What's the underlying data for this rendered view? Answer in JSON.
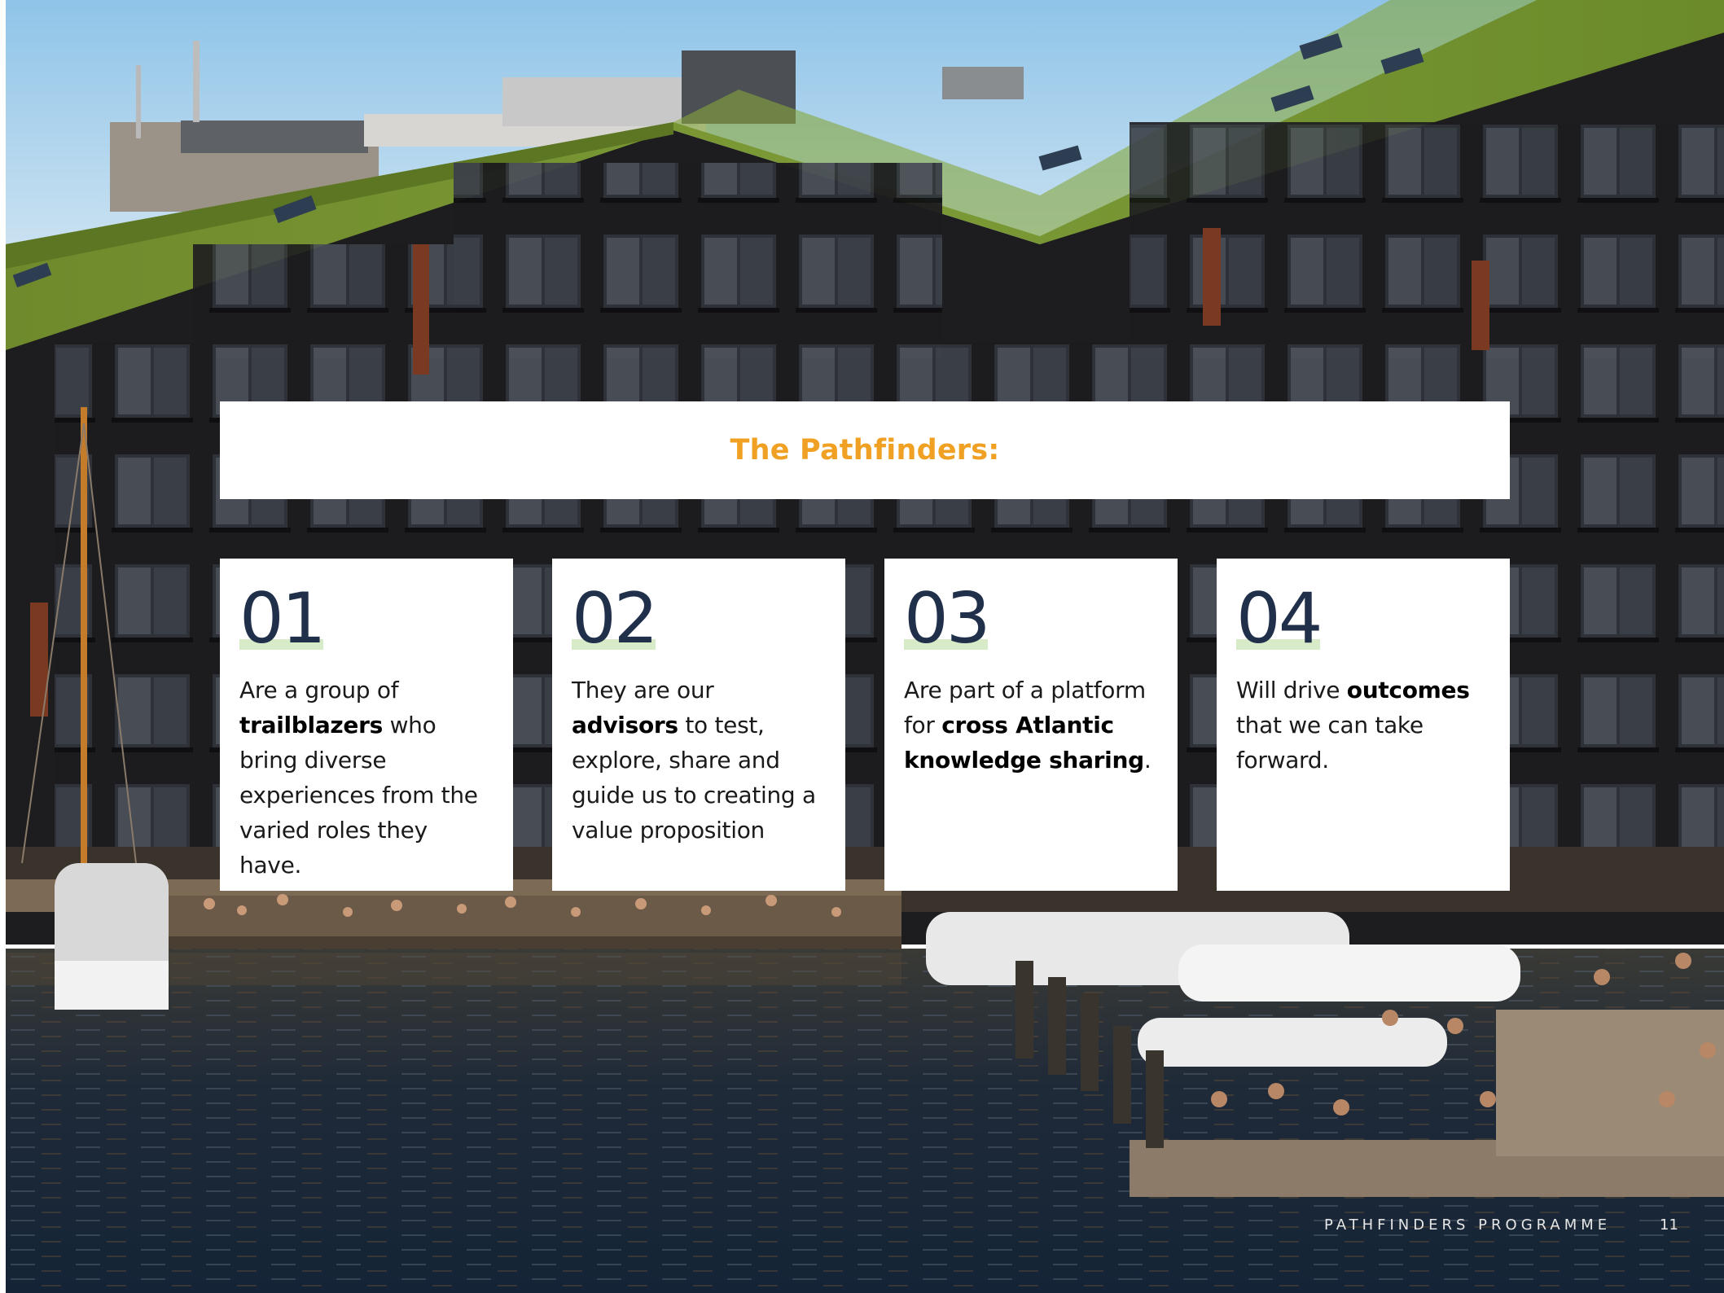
{
  "title": "The Pathfinders:",
  "colors": {
    "accent": "#f0a124",
    "number_text": "#20304a",
    "number_highlight": "#d8ebc8"
  },
  "cards": [
    {
      "number": "01",
      "segments": [
        {
          "text": "Are a group of ",
          "bold": false
        },
        {
          "text": "trailblazers",
          "bold": true
        },
        {
          "text": " who bring diverse experiences from the varied roles they have.",
          "bold": false
        }
      ]
    },
    {
      "number": "02",
      "segments": [
        {
          "text": "They are our ",
          "bold": false
        },
        {
          "text": "advisors",
          "bold": true
        },
        {
          "text": " to test, explore, share and guide us to creating a value proposition",
          "bold": false
        }
      ]
    },
    {
      "number": "03",
      "segments": [
        {
          "text": "Are part of a platform for ",
          "bold": false
        },
        {
          "text": "cross Atlantic knowledge sharing",
          "bold": true
        },
        {
          "text": ".",
          "bold": false
        }
      ]
    },
    {
      "number": "04",
      "segments": [
        {
          "text": "Will drive ",
          "bold": false
        },
        {
          "text": "outcomes",
          "bold": true
        },
        {
          "text": " that we can take forward.",
          "bold": false
        }
      ]
    }
  ],
  "footer": {
    "label": "PATHFINDERS PROGRAMME",
    "page_number": "11"
  }
}
